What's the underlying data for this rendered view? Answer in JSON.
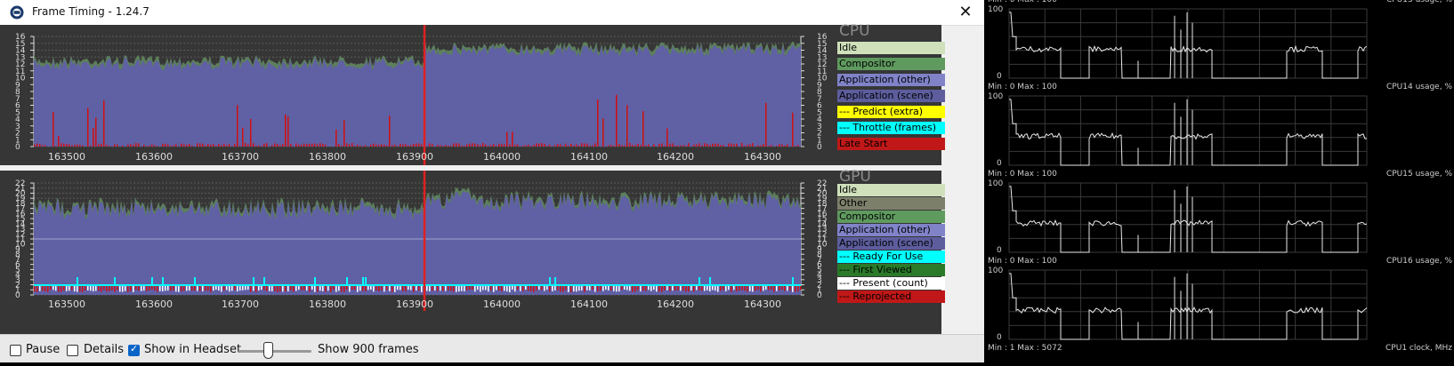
{
  "window": {
    "title": "Frame Timing - 1.24.7",
    "close_icon": "close-icon"
  },
  "x_ticks": [
    "163500",
    "163600",
    "163700",
    "163800",
    "163900",
    "164000",
    "164100",
    "164200",
    "164300"
  ],
  "cpu_panel": {
    "title": "CPU",
    "y_ticks": [
      "16",
      "15",
      "14",
      "13",
      "12",
      "11",
      "10",
      "9",
      "8",
      "7",
      "6",
      "5",
      "4",
      "3",
      "2",
      "1",
      "0"
    ],
    "legend": [
      {
        "label": "Idle",
        "color": "#cfe0bb"
      },
      {
        "label": "Compositor",
        "color": "#5f9a5f"
      },
      {
        "label": "Application (other)",
        "color": "#8083c8"
      },
      {
        "label": "Application (scene)",
        "color": "#5d5d9e"
      },
      {
        "label": "--- Predict (extra)",
        "color": "#ffff00"
      },
      {
        "label": "--- Throttle (frames)",
        "color": "#00ffff"
      },
      {
        "label": "Late Start",
        "color": "#c01818"
      }
    ]
  },
  "gpu_panel": {
    "title": "GPU",
    "y_ticks": [
      "22",
      "21",
      "20",
      "19",
      "18",
      "17",
      "16",
      "15",
      "14",
      "13",
      "12",
      "11",
      "10",
      "9",
      "8",
      "7",
      "6",
      "5",
      "4",
      "3",
      "2",
      "1",
      "0"
    ],
    "legend": [
      {
        "label": "Idle",
        "color": "#cfe0bb"
      },
      {
        "label": "Other",
        "color": "#7c7f6a"
      },
      {
        "label": "Compositor",
        "color": "#5f9a5f"
      },
      {
        "label": "Application (other)",
        "color": "#8083c8"
      },
      {
        "label": "Application (scene)",
        "color": "#5d5d9e"
      },
      {
        "label": "--- Ready For Use",
        "color": "#00ffff"
      },
      {
        "label": "--- First Viewed",
        "color": "#2a7a2a"
      },
      {
        "label": "--- Present (count)",
        "color": "#ffffff"
      },
      {
        "label": "--- Reprojected",
        "color": "#c01818"
      }
    ]
  },
  "controls": {
    "pause_label": "Pause",
    "pause_checked": false,
    "details_label": "Details",
    "details_checked": false,
    "headset_label": "Show in Headset",
    "headset_checked": true,
    "frames_label": "Show 900 frames"
  },
  "cpu_monitor": [
    {
      "title": "CPU13 usage, %",
      "min_max": "Min : 0   Max : 100",
      "ymax": "100",
      "ymin": "0"
    },
    {
      "title": "CPU14 usage, %",
      "min_max": "Min : 0   Max : 100",
      "ymax": "100",
      "ymin": "0"
    },
    {
      "title": "CPU15 usage, %",
      "min_max": "Min : 0   Max : 100",
      "ymax": "100",
      "ymin": "0"
    },
    {
      "title": "CPU16 usage, %",
      "min_max": "Min : 0   Max : 100",
      "ymax": "100",
      "ymin": "0"
    },
    {
      "title": "CPU1 clock, MHz",
      "min_max": "Min : 1   Max : 5072",
      "ymax": "",
      "ymin": ""
    }
  ],
  "colors": {
    "app_scene": "#6060a4",
    "compositor": "#4f7f4f",
    "late_start": "#d01010",
    "cursor_line": "#e02020"
  }
}
